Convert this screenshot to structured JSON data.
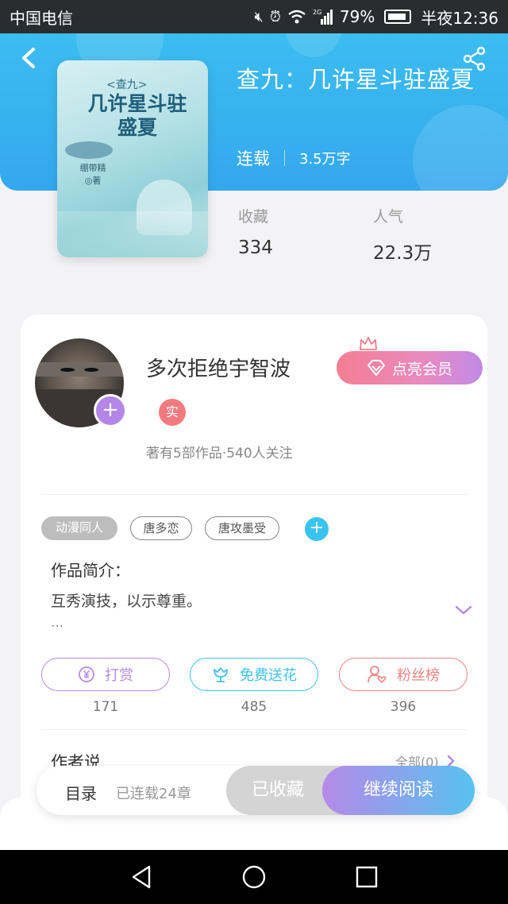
{
  "status_bar": {
    "carrier": "中国电信",
    "signal_tag": "2G",
    "battery": "79%",
    "time": "半夜12:36",
    "icons": [
      "mute-icon",
      "alarm-icon",
      "wifi-icon",
      "signal-icon",
      "battery-icon"
    ]
  },
  "book": {
    "cover": {
      "subtitle": "<查九>",
      "title": "几许星斗驻盛夏",
      "author_line1": "绷带精",
      "author_line2": "◎著"
    },
    "title": "查九：几许星斗驻盛夏",
    "status": "连载",
    "word_count": "3.5万字",
    "stats": [
      {
        "label": "收藏",
        "value": "334"
      },
      {
        "label": "人气",
        "value": "22.3万"
      }
    ]
  },
  "author": {
    "name": "多次拒绝宇智波",
    "badge": "实",
    "stats": "著有5部作品·540人关注",
    "vip_label": "点亮会员"
  },
  "tags": [
    "动漫同人",
    "唐多恋",
    "唐攻墨受"
  ],
  "intro": {
    "heading": "作品简介：",
    "text": "互秀演技，以示尊重。",
    "more": "…"
  },
  "actions": [
    {
      "label": "打赏",
      "count": "171",
      "icon": "yen-coin-icon",
      "color": "#b88be6"
    },
    {
      "label": "免费送花",
      "count": "485",
      "icon": "flower-icon",
      "color": "#3fc3ee"
    },
    {
      "label": "粉丝榜",
      "count": "396",
      "icon": "fan-user-icon",
      "color": "#ef8585"
    }
  ],
  "author_says": {
    "heading": "作者说",
    "more": "全部(0)"
  },
  "bottom_bar": {
    "toc_label": "目录",
    "toc_sub": "已连载24章",
    "collected": "已收藏",
    "continue": "继续阅读"
  },
  "colors": {
    "header": "#3bb6f0",
    "accent_purple": "#b486e8",
    "accent_cyan": "#39c4ef",
    "accent_pink": "#f27a7e"
  }
}
